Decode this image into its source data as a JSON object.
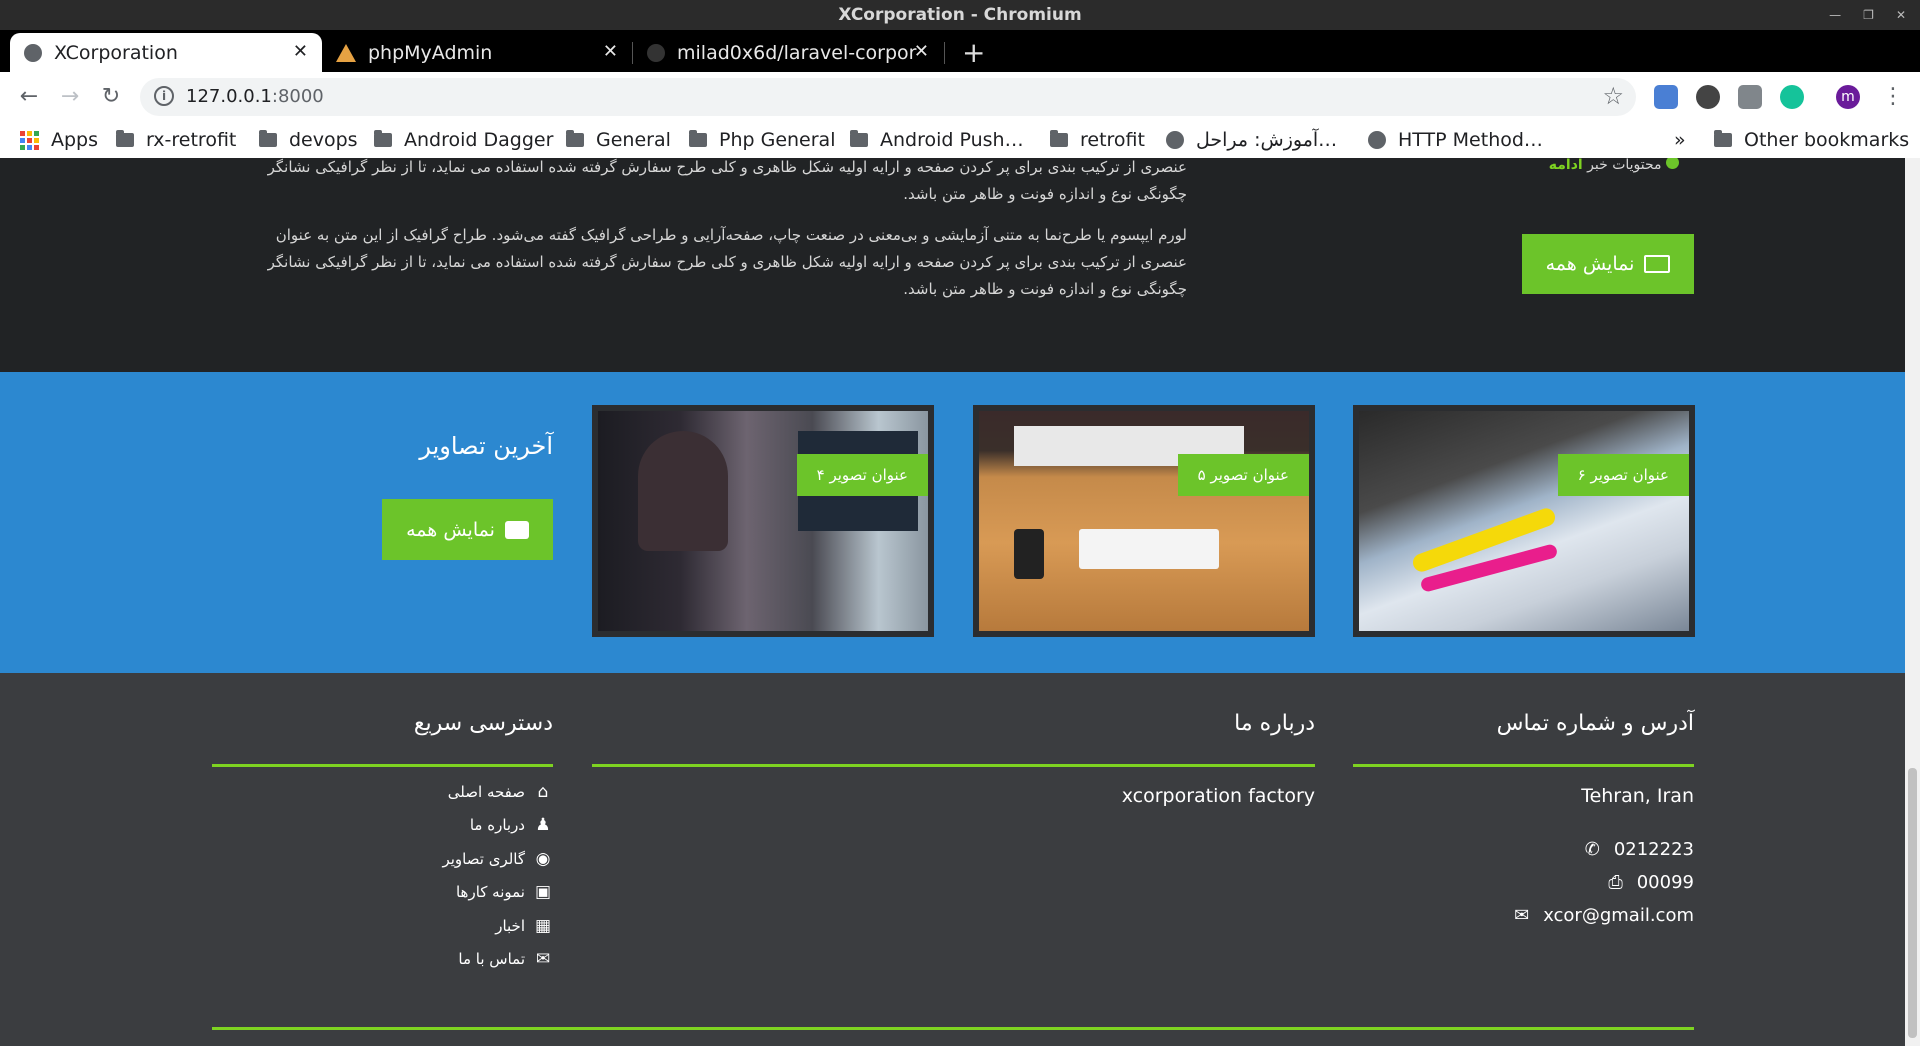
{
  "window": {
    "title": "XCorporation - Chromium"
  },
  "tabs": [
    {
      "title": "XCorporation",
      "icon": "globe-icon"
    },
    {
      "title": "phpMyAdmin",
      "icon": "phpmyadmin-icon"
    },
    {
      "title": "milad0x6d/laravel-corpora",
      "icon": "github-icon"
    }
  ],
  "address_bar": {
    "host": "127.0.0.1",
    "port": ":8000"
  },
  "bookmarks": {
    "items": [
      "Apps",
      "rx-retrofit",
      "devops",
      "Android Dagger",
      "General",
      "Php General",
      "Android Push…",
      "retrofit",
      "آموزش: مراحل…",
      "HTTP Method…"
    ],
    "overflow": "»",
    "other": "Other bookmarks"
  },
  "news": {
    "more_prefix": "محتویات خبر",
    "more_link": "ادامه",
    "para1_line1": "عنصری از ترکیب بندی برای پر کردن صفحه و ارایه اولیه شکل ظاهری و کلی طرح سفارش گرفته شده استفاده می نماید، تا از نظر گرافیکی نشانگر",
    "para1_line2": "چگونگی نوع و اندازه فونت و ظاهر متن باشد.",
    "para2_line1": "لورم ایپسوم یا طرح‌نما به متنی آزمایشی و بی‌معنی در صنعت چاپ، صفحه‌آرایی و طراحی گرافیک گفته می‌شود. طراح گرافیک از این متن به عنوان",
    "para2_line2": "عنصری از ترکیب بندی برای پر کردن صفحه و ارایه اولیه شکل ظاهری و کلی طرح سفارش گرفته شده استفاده می نماید، تا از نظر گرافیکی نشانگر",
    "para2_line3": "چگونگی نوع و اندازه فونت و ظاهر متن باشد.",
    "show_all": "نمایش همه"
  },
  "gallery": {
    "title": "آخرین تصاویر",
    "show_all": "نمایش همه",
    "items": [
      {
        "label": "عنوان تصویر ۶"
      },
      {
        "label": "عنوان تصویر ۵"
      },
      {
        "label": "عنوان تصویر ۴"
      }
    ]
  },
  "footer": {
    "contact": {
      "heading": "آدرس و شماره تماس",
      "address": "Tehran, Iran",
      "phone": "0212223",
      "fax": "00099",
      "email": "xcor@gmail.com"
    },
    "about": {
      "heading": "درباره ما",
      "text": "xcorporation factory"
    },
    "quick": {
      "heading": "دسترسی سریع",
      "links": [
        "صفحه اصلی",
        "درباره ما",
        "گالری تصاویر",
        "نمونه کارها",
        "اخبار",
        "تماس با ما"
      ]
    }
  },
  "colors": {
    "green": "#6cc42a",
    "blue": "#2c88d0",
    "dark": "#212325",
    "footer": "#3b3d40"
  }
}
